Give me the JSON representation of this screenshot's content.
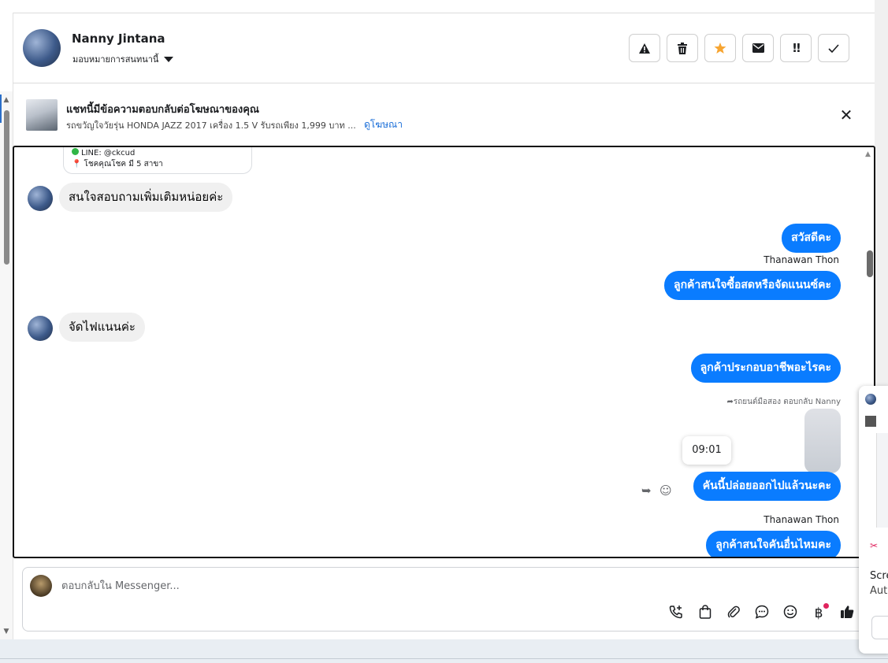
{
  "header": {
    "contact_name": "Nanny Jintana",
    "assign_label": "มอบหมายการสนทนานี้",
    "toolbar": [
      {
        "name": "report-spam-button",
        "icon": "warning-triangle-icon",
        "glyph": "▲"
      },
      {
        "name": "delete-button",
        "icon": "trash-icon",
        "glyph": "🗑"
      },
      {
        "name": "star-button",
        "icon": "star-icon",
        "glyph": "★"
      },
      {
        "name": "mark-unread-button",
        "icon": "envelope-icon",
        "glyph": "✉"
      },
      {
        "name": "follow-up-button",
        "icon": "exclamation-icon",
        "glyph": "!!"
      },
      {
        "name": "mark-done-button",
        "icon": "check-icon",
        "glyph": "✓"
      }
    ],
    "star_color": "#f7a531"
  },
  "ad_banner": {
    "title": "แชทนี้มีข้อความตอบกลับต่อโฆษณาของคุณ",
    "subtitle": "รถขวัญใจวัยรุ่น HONDA JAZZ 2017 เครื่อง 1.5 V รับรถเพียง 1,999 บาท ...",
    "link": "ดูโฆษณา",
    "close_glyph": "✕"
  },
  "chat": {
    "card_lines": [
      "LINE: @ckcud",
      "โชคคุณโชค มี 5 สาขา"
    ],
    "messages": [
      {
        "dir": "in",
        "text": "สนใจสอบถามเพิ่มเติมหน่อยค่ะ"
      },
      {
        "dir": "out",
        "text": "สวัสดีคะ"
      },
      {
        "dir": "out",
        "sender": "Thanawan Thon",
        "text": "ลูกค้าสนใจซื้อสดหรือจัดแนนซ์คะ"
      },
      {
        "dir": "in",
        "text": "จัดไฟแนนค่ะ"
      },
      {
        "dir": "out",
        "text": "ลูกค้าประกอบอาชีพอะไรคะ"
      },
      {
        "dir": "out",
        "reply_note": "รถยนต์มือสอง ตอบกลับ Nanny",
        "time_tooltip": "09:01",
        "text": "คันนี้ปล่อยออกไปแล้วนะคะ"
      },
      {
        "dir": "out",
        "sender": "Thanawan Thon",
        "text": "ลูกค้าสนใจคันอื่นไหมคะ"
      }
    ],
    "bubble_color": "#0a7cff"
  },
  "composer": {
    "placeholder": "ตอบกลับใน Messenger...",
    "icons": [
      "phone-add-icon",
      "shopping-bag-icon",
      "paperclip-icon",
      "chat-bubble-icon",
      "emoji-icon",
      "baht-icon",
      "thumbs-up-icon"
    ]
  },
  "side_panel": {
    "line1": "Scre",
    "line2": "Aut"
  }
}
